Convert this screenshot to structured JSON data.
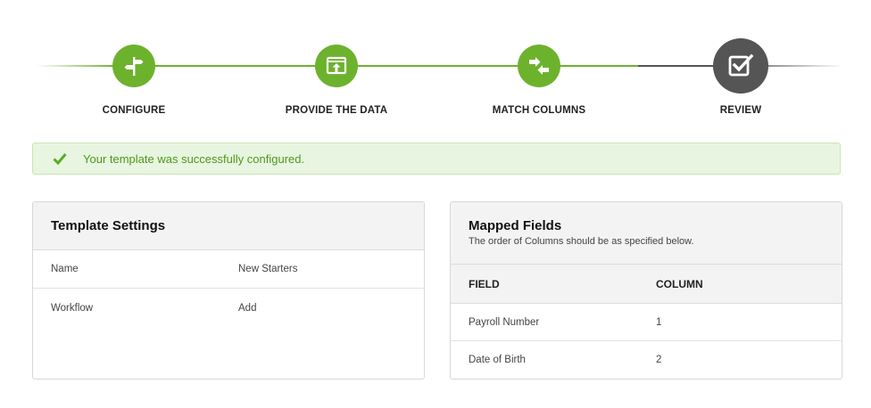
{
  "stepper": {
    "steps": [
      {
        "label": "CONFIGURE",
        "icon": "signpost-icon",
        "state": "done"
      },
      {
        "label": "PROVIDE THE DATA",
        "icon": "upload-window-icon",
        "state": "done"
      },
      {
        "label": "MATCH COLUMNS",
        "icon": "swap-arrows-icon",
        "state": "done"
      },
      {
        "label": "REVIEW",
        "icon": "checkbox-icon",
        "state": "active"
      }
    ],
    "colors": {
      "done": "#6db22d",
      "active": "#555555"
    }
  },
  "alert": {
    "icon": "checkmark-icon",
    "message": "Your template was successfully configured.",
    "color": "#4d9a1d",
    "background": "#e8f5e0"
  },
  "template_settings": {
    "title": "Template Settings",
    "rows": [
      {
        "label": "Name",
        "value": "New Starters"
      },
      {
        "label": "Workflow",
        "value": "Add"
      }
    ]
  },
  "mapped_fields": {
    "title": "Mapped Fields",
    "subtitle": "The order of Columns should be as specified below.",
    "columns": [
      "FIELD",
      "COLUMN"
    ],
    "rows": [
      {
        "field": "Payroll Number",
        "column": "1"
      },
      {
        "field": "Date of Birth",
        "column": "2"
      }
    ]
  }
}
